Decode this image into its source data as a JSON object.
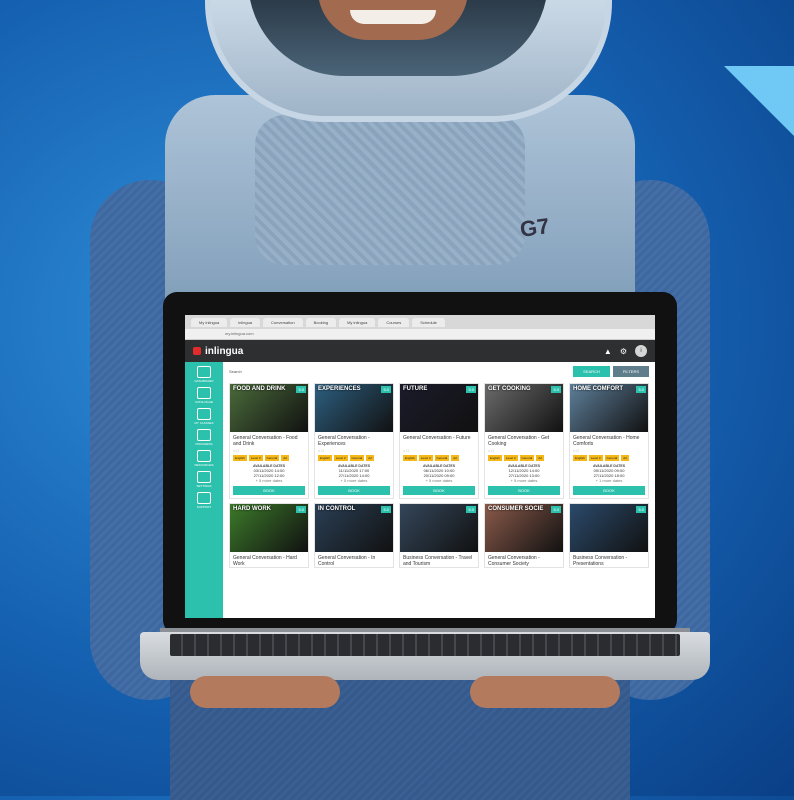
{
  "scene": {
    "suit_label": "G7",
    "colors": {
      "background": "#1560b0",
      "accent": "#2cc1ad",
      "chip": "#f5b818",
      "appbar": "#2d2f31"
    }
  },
  "browser": {
    "tabs": [
      "My inlingua",
      "inlingua",
      "Conversation",
      "Booking",
      "My inlingua",
      "Courses",
      "Schedule"
    ],
    "address": "my.inlingua.com"
  },
  "app": {
    "logo": "inlingua",
    "icons": [
      "bell-icon",
      "settings-icon",
      "avatar"
    ],
    "avatar_initial": "i",
    "sidebar": [
      {
        "label": "DASHBOARD",
        "icon": "home-icon"
      },
      {
        "label": "CATALOGUE",
        "icon": "grid-icon"
      },
      {
        "label": "MY CLASSES",
        "icon": "calendar-icon"
      },
      {
        "label": "PROGRESS",
        "icon": "chart-icon"
      },
      {
        "label": "RESOURCES",
        "icon": "book-icon"
      },
      {
        "label": "SETTINGS",
        "icon": "gear-icon"
      },
      {
        "label": "SUPPORT",
        "icon": "help-icon"
      }
    ],
    "breadcrumb": "Search",
    "search_label": "SEARCH",
    "filters_label": "FILTERS",
    "cards": [
      {
        "thumb_title": "FOOD AND DRINK",
        "badge": "5.0",
        "title": "General Conversation - Food and Drink",
        "chips": [
          "English",
          "Level 3",
          "General",
          "A2"
        ],
        "dates_header": "AVAILABLE DATES",
        "dates": [
          "03/11/2020 14:00",
          "27/11/2020 12:00"
        ],
        "more": "+ 5 more dates",
        "book": "BOOK",
        "color": "#4a6b3a"
      },
      {
        "thumb_title": "EXPERIENCES",
        "badge": "5.0",
        "title": "General Conversation - Experiences",
        "chips": [
          "English",
          "Level 3",
          "General",
          "A2"
        ],
        "dates_header": "AVAILABLE DATES",
        "dates": [
          "11/11/2020 17:00",
          "27/11/2020 14:00"
        ],
        "more": "+ 5 more dates",
        "book": "BOOK",
        "color": "#2d5f80"
      },
      {
        "thumb_title": "FUTURE",
        "badge": "5.0",
        "title": "General Conversation - Future",
        "chips": [
          "English",
          "Level 3",
          "General",
          "A2"
        ],
        "dates_header": "AVAILABLE DATES",
        "dates": [
          "06/11/2020 10:00",
          "20/11/2020 09:00"
        ],
        "more": "+ 5 more dates",
        "book": "BOOK",
        "color": "#1b1b2b"
      },
      {
        "thumb_title": "GET COOKING",
        "badge": "5.0",
        "title": "General Conversation - Get Cooking",
        "chips": [
          "English",
          "Level 3",
          "General",
          "A2"
        ],
        "dates_header": "AVAILABLE DATES",
        "dates": [
          "12/11/2020 14:00",
          "27/11/2020 13:00"
        ],
        "more": "+ 5 more dates",
        "book": "BOOK",
        "color": "#6b6b6b"
      },
      {
        "thumb_title": "HOME COMFORT",
        "badge": "5.0",
        "title": "General Conversation - Home Comforts",
        "chips": [
          "English",
          "Level 3",
          "General",
          "A2"
        ],
        "dates_header": "AVAILABLE DATES",
        "dates": [
          "09/11/2020 09:00",
          "27/11/2020 18:00"
        ],
        "more": "+ 1 more dates",
        "book": "BOOK",
        "color": "#5e7f9a"
      },
      {
        "thumb_title": "HARD WORK",
        "badge": "5.0",
        "title": "General Conversation - Hard Work",
        "color": "#3c7a2a"
      },
      {
        "thumb_title": "IN CONTROL",
        "badge": "5.0",
        "title": "General Conversation - In Control",
        "color": "#2a3f55"
      },
      {
        "thumb_title": "",
        "badge": "5.0",
        "title": "Business Conversation - Travel and Tourism",
        "color": "#34465a"
      },
      {
        "thumb_title": "CONSUMER SOCIE",
        "badge": "5.0",
        "title": "General Conversation - Consumer Society",
        "color": "#8a5a4a"
      },
      {
        "thumb_title": "",
        "badge": "5.0",
        "title": "Business Conversation - Presentations",
        "color": "#2b4a6b"
      }
    ]
  }
}
